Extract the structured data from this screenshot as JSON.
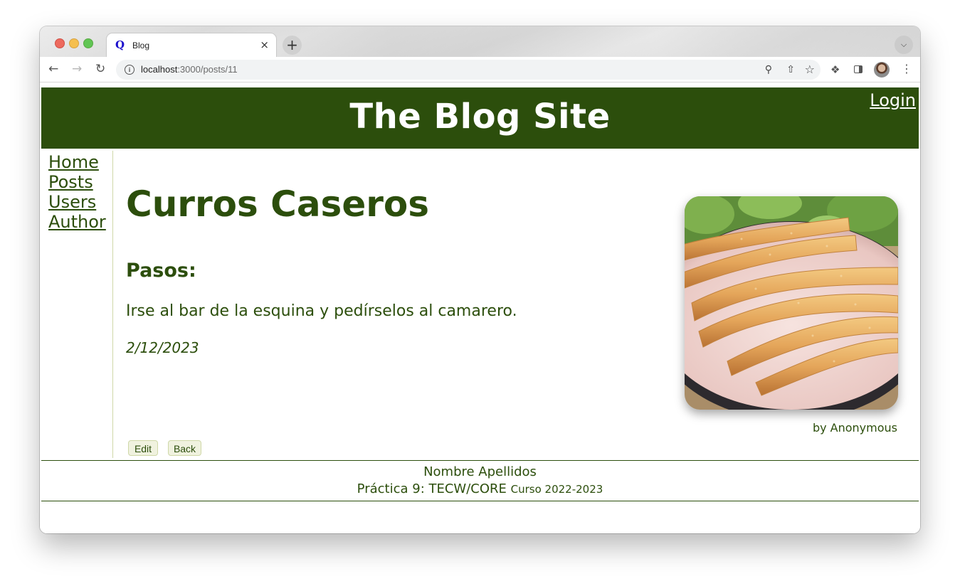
{
  "browser": {
    "tab_title": "Blog",
    "tab_favicon": "Q",
    "tab_close": "×",
    "new_tab": "+",
    "url_host": "localhost",
    "url_rest": ":3000/posts/11"
  },
  "header": {
    "site_title": "The Blog Site",
    "login": "Login"
  },
  "nav": {
    "items": [
      {
        "label": "Home"
      },
      {
        "label": "Posts"
      },
      {
        "label": "Users"
      },
      {
        "label": "Author"
      }
    ]
  },
  "post": {
    "title": "Curros Caseros",
    "subtitle": "Pasos:",
    "body": "Irse al bar de la esquina y pedírselos al camarero.",
    "date": "2/12/2023",
    "author": "by Anonymous",
    "image_icon": "churros-photo"
  },
  "actions": {
    "edit": "Edit",
    "back": "Back"
  },
  "footer": {
    "name": "Nombre Apellidos",
    "course": "Práctica 9: TECW/CORE",
    "year": "Curso 2022-2023"
  },
  "colors": {
    "brand_green": "#2c4e0c",
    "button_bg": "#f0f2df"
  }
}
